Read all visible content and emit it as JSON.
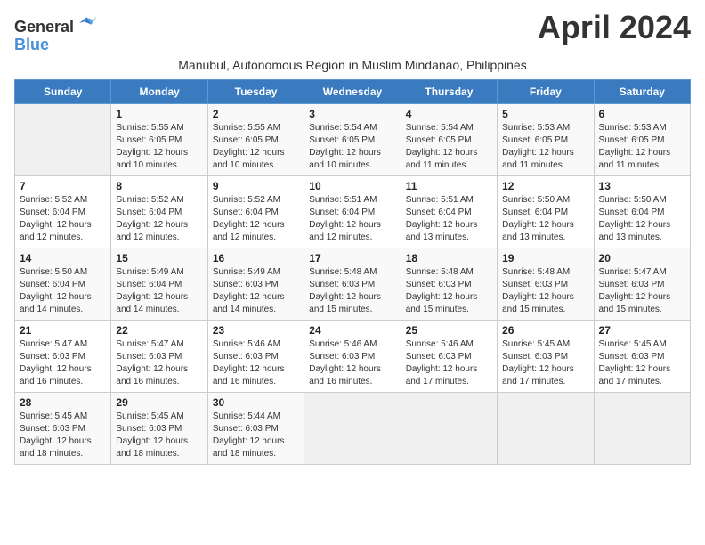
{
  "header": {
    "logo_line1": "General",
    "logo_line2": "Blue",
    "month_title": "April 2024",
    "subtitle": "Manubul, Autonomous Region in Muslim Mindanao, Philippines"
  },
  "weekdays": [
    "Sunday",
    "Monday",
    "Tuesday",
    "Wednesday",
    "Thursday",
    "Friday",
    "Saturday"
  ],
  "weeks": [
    [
      {
        "day": "",
        "info": ""
      },
      {
        "day": "1",
        "info": "Sunrise: 5:55 AM\nSunset: 6:05 PM\nDaylight: 12 hours\nand 10 minutes."
      },
      {
        "day": "2",
        "info": "Sunrise: 5:55 AM\nSunset: 6:05 PM\nDaylight: 12 hours\nand 10 minutes."
      },
      {
        "day": "3",
        "info": "Sunrise: 5:54 AM\nSunset: 6:05 PM\nDaylight: 12 hours\nand 10 minutes."
      },
      {
        "day": "4",
        "info": "Sunrise: 5:54 AM\nSunset: 6:05 PM\nDaylight: 12 hours\nand 11 minutes."
      },
      {
        "day": "5",
        "info": "Sunrise: 5:53 AM\nSunset: 6:05 PM\nDaylight: 12 hours\nand 11 minutes."
      },
      {
        "day": "6",
        "info": "Sunrise: 5:53 AM\nSunset: 6:05 PM\nDaylight: 12 hours\nand 11 minutes."
      }
    ],
    [
      {
        "day": "7",
        "info": "Sunrise: 5:52 AM\nSunset: 6:04 PM\nDaylight: 12 hours\nand 12 minutes."
      },
      {
        "day": "8",
        "info": "Sunrise: 5:52 AM\nSunset: 6:04 PM\nDaylight: 12 hours\nand 12 minutes."
      },
      {
        "day": "9",
        "info": "Sunrise: 5:52 AM\nSunset: 6:04 PM\nDaylight: 12 hours\nand 12 minutes."
      },
      {
        "day": "10",
        "info": "Sunrise: 5:51 AM\nSunset: 6:04 PM\nDaylight: 12 hours\nand 12 minutes."
      },
      {
        "day": "11",
        "info": "Sunrise: 5:51 AM\nSunset: 6:04 PM\nDaylight: 12 hours\nand 13 minutes."
      },
      {
        "day": "12",
        "info": "Sunrise: 5:50 AM\nSunset: 6:04 PM\nDaylight: 12 hours\nand 13 minutes."
      },
      {
        "day": "13",
        "info": "Sunrise: 5:50 AM\nSunset: 6:04 PM\nDaylight: 12 hours\nand 13 minutes."
      }
    ],
    [
      {
        "day": "14",
        "info": "Sunrise: 5:50 AM\nSunset: 6:04 PM\nDaylight: 12 hours\nand 14 minutes."
      },
      {
        "day": "15",
        "info": "Sunrise: 5:49 AM\nSunset: 6:04 PM\nDaylight: 12 hours\nand 14 minutes."
      },
      {
        "day": "16",
        "info": "Sunrise: 5:49 AM\nSunset: 6:03 PM\nDaylight: 12 hours\nand 14 minutes."
      },
      {
        "day": "17",
        "info": "Sunrise: 5:48 AM\nSunset: 6:03 PM\nDaylight: 12 hours\nand 15 minutes."
      },
      {
        "day": "18",
        "info": "Sunrise: 5:48 AM\nSunset: 6:03 PM\nDaylight: 12 hours\nand 15 minutes."
      },
      {
        "day": "19",
        "info": "Sunrise: 5:48 AM\nSunset: 6:03 PM\nDaylight: 12 hours\nand 15 minutes."
      },
      {
        "day": "20",
        "info": "Sunrise: 5:47 AM\nSunset: 6:03 PM\nDaylight: 12 hours\nand 15 minutes."
      }
    ],
    [
      {
        "day": "21",
        "info": "Sunrise: 5:47 AM\nSunset: 6:03 PM\nDaylight: 12 hours\nand 16 minutes."
      },
      {
        "day": "22",
        "info": "Sunrise: 5:47 AM\nSunset: 6:03 PM\nDaylight: 12 hours\nand 16 minutes."
      },
      {
        "day": "23",
        "info": "Sunrise: 5:46 AM\nSunset: 6:03 PM\nDaylight: 12 hours\nand 16 minutes."
      },
      {
        "day": "24",
        "info": "Sunrise: 5:46 AM\nSunset: 6:03 PM\nDaylight: 12 hours\nand 16 minutes."
      },
      {
        "day": "25",
        "info": "Sunrise: 5:46 AM\nSunset: 6:03 PM\nDaylight: 12 hours\nand 17 minutes."
      },
      {
        "day": "26",
        "info": "Sunrise: 5:45 AM\nSunset: 6:03 PM\nDaylight: 12 hours\nand 17 minutes."
      },
      {
        "day": "27",
        "info": "Sunrise: 5:45 AM\nSunset: 6:03 PM\nDaylight: 12 hours\nand 17 minutes."
      }
    ],
    [
      {
        "day": "28",
        "info": "Sunrise: 5:45 AM\nSunset: 6:03 PM\nDaylight: 12 hours\nand 18 minutes."
      },
      {
        "day": "29",
        "info": "Sunrise: 5:45 AM\nSunset: 6:03 PM\nDaylight: 12 hours\nand 18 minutes."
      },
      {
        "day": "30",
        "info": "Sunrise: 5:44 AM\nSunset: 6:03 PM\nDaylight: 12 hours\nand 18 minutes."
      },
      {
        "day": "",
        "info": ""
      },
      {
        "day": "",
        "info": ""
      },
      {
        "day": "",
        "info": ""
      },
      {
        "day": "",
        "info": ""
      }
    ]
  ]
}
